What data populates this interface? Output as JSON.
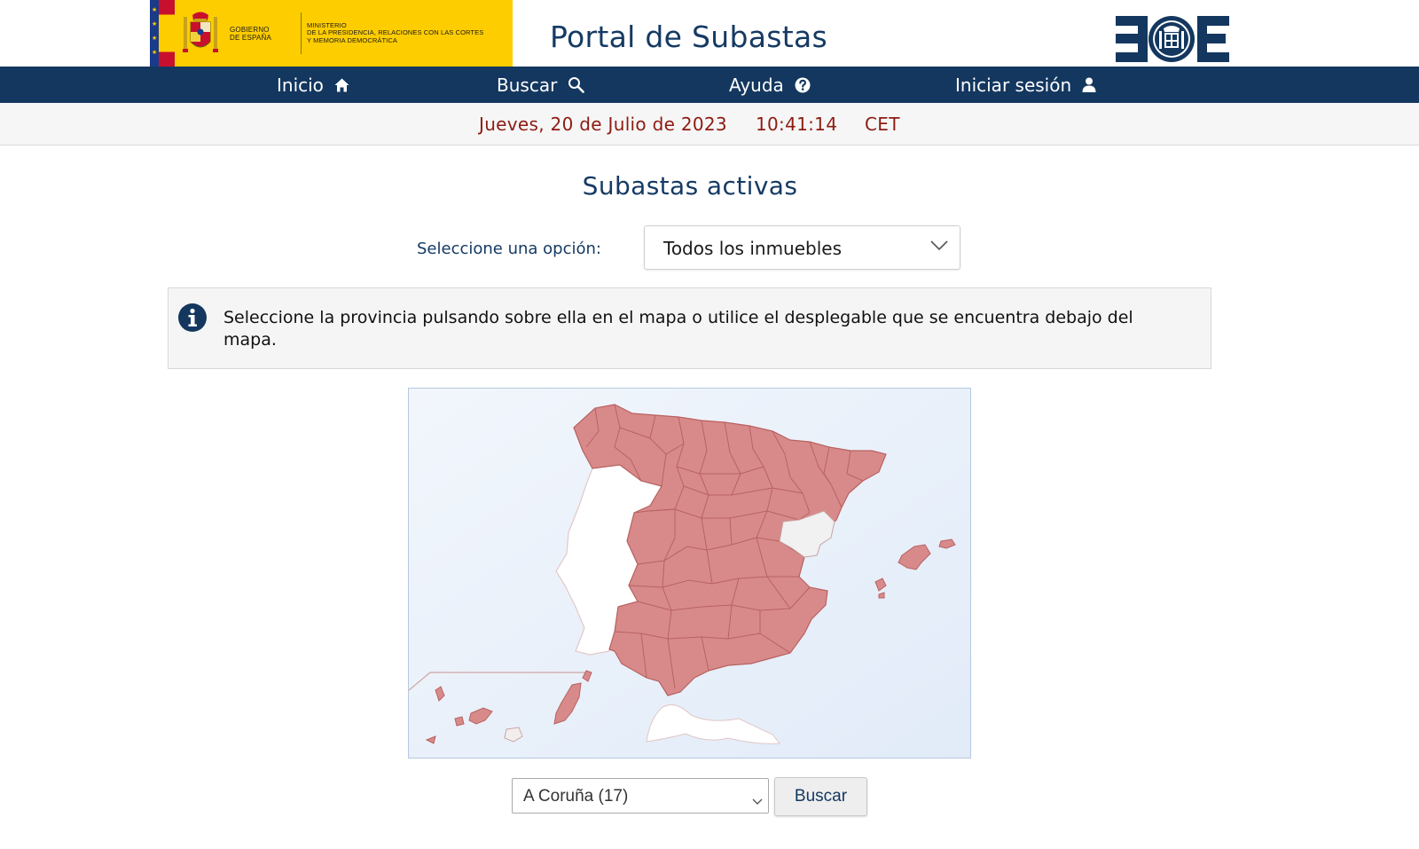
{
  "header": {
    "gov_line1": "GOBIERNO",
    "gov_line2": "DE ESPAÑA",
    "ministry_line1": "MINISTERIO",
    "ministry_line2": "DE LA PRESIDENCIA, RELACIONES CON LAS CORTES",
    "ministry_line3": "Y MEMORIA DEMOCRÁTICA",
    "portal_title": "Portal de Subastas",
    "boe_logo_icon": "boe-logo"
  },
  "nav": {
    "items": [
      {
        "label": "Inicio",
        "icon": "home-icon"
      },
      {
        "label": "Buscar",
        "icon": "search-icon"
      },
      {
        "label": "Ayuda",
        "icon": "help-icon"
      },
      {
        "label": "Iniciar sesión",
        "icon": "user-icon"
      }
    ]
  },
  "datebar": {
    "date": "Jueves, 20 de Julio de 2023",
    "time": "10:41:14",
    "timezone": "CET"
  },
  "main": {
    "title": "Subastas activas",
    "select_label": "Seleccione una opción:",
    "select_value": "Todos los inmuebles",
    "info_text": "Seleccione la provincia pulsando sobre ella en el mapa o utilice el desplegable que se encuentra debajo del mapa.",
    "province_value": "A Coruña (17)",
    "search_button": "Buscar"
  },
  "colors": {
    "nav_bg": "#13375f",
    "title_blue": "#153a63",
    "date_red": "#8d1b12",
    "map_province": "#d88a8a",
    "map_sea": "#eaf1fa",
    "gov_yellow": "#fecd00"
  }
}
